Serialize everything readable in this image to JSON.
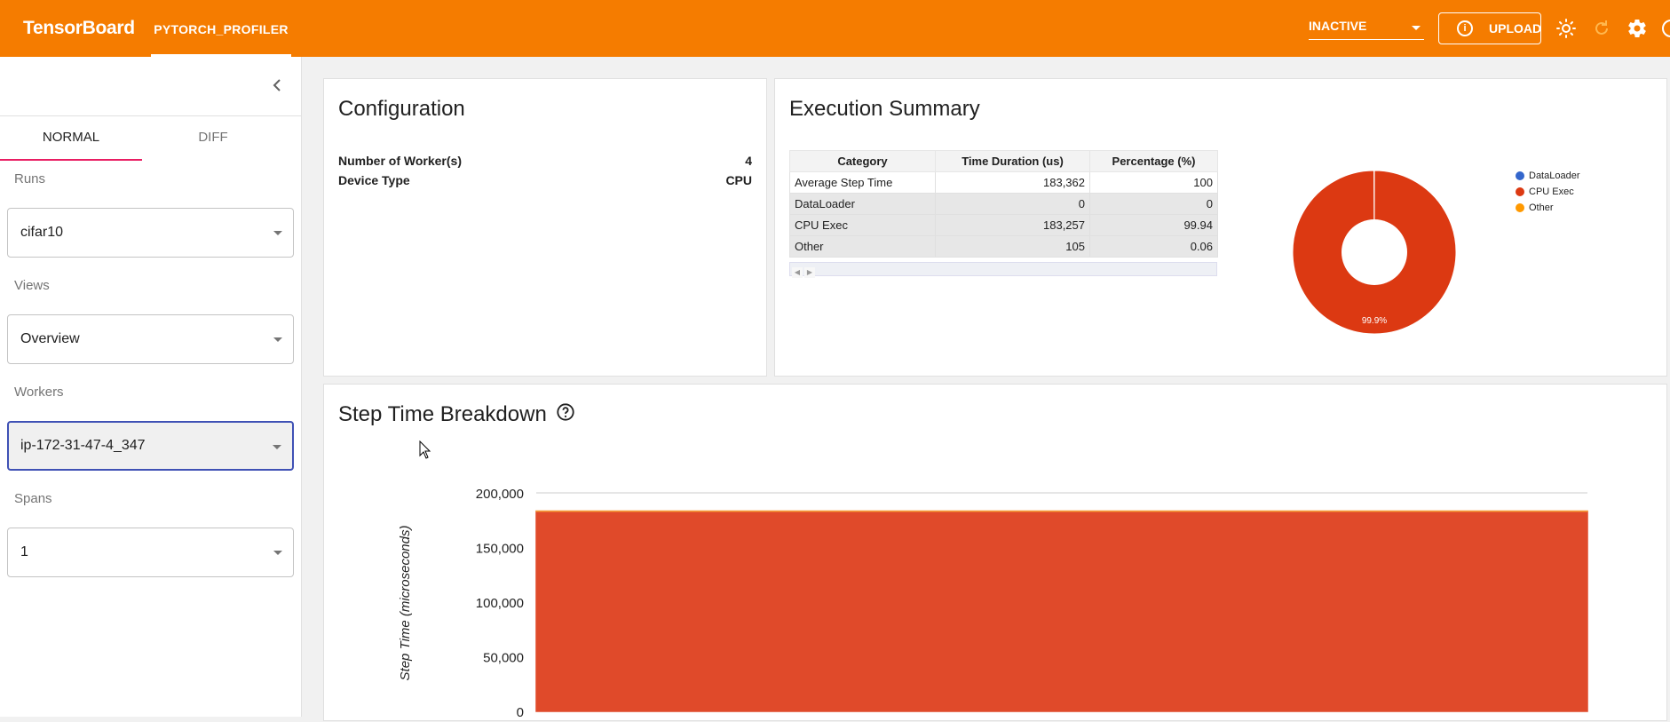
{
  "topbar": {
    "brand": "TensorBoard",
    "plugin_tab": "PYTORCH_PROFILER",
    "inactive_select": "INACTIVE",
    "upload_label": "UPLOAD",
    "icons": [
      "info-icon",
      "brightness-icon",
      "refresh-icon",
      "settings-icon",
      "help-icon"
    ]
  },
  "sidebar": {
    "tabs": [
      "NORMAL",
      "DIFF"
    ],
    "active_tab": "NORMAL",
    "fields": [
      {
        "label": "Runs",
        "value": "cifar10"
      },
      {
        "label": "Views",
        "value": "Overview"
      },
      {
        "label": "Workers",
        "value": "ip-172-31-47-4_347"
      },
      {
        "label": "Spans",
        "value": "1"
      }
    ]
  },
  "configuration": {
    "title": "Configuration",
    "rows": [
      {
        "key": "Number of Worker(s)",
        "value": "4"
      },
      {
        "key": "Device Type",
        "value": "CPU"
      }
    ]
  },
  "execution_summary": {
    "title": "Execution Summary",
    "table": {
      "headers": [
        "Category",
        "Time Duration (us)",
        "Percentage (%)"
      ],
      "rows": [
        [
          "Average Step Time",
          "183,362",
          "100"
        ],
        [
          "DataLoader",
          "0",
          "0"
        ],
        [
          "CPU Exec",
          "183,257",
          "99.94"
        ],
        [
          "Other",
          "105",
          "0.06"
        ]
      ]
    },
    "donut_label": "99.9%",
    "legend": [
      {
        "name": "DataLoader",
        "color": "#3366cc"
      },
      {
        "name": "CPU Exec",
        "color": "#dc3912"
      },
      {
        "name": "Other",
        "color": "#ff9900"
      }
    ],
    "donut_values": [
      0,
      183257,
      105
    ]
  },
  "step_time": {
    "title": "Step Time Breakdown"
  },
  "chart_data": {
    "type": "area",
    "ylabel": "Step Time (microseconds)",
    "ylim": [
      0,
      200000
    ],
    "yticks": [
      "200,000",
      "150,000",
      "100,000",
      "50,000",
      "0"
    ],
    "ytick_values": [
      200000,
      150000,
      100000,
      50000,
      0
    ],
    "series": [
      {
        "name": "CPU Exec",
        "color": "#e04a2a",
        "values": [
          183257,
          183257
        ]
      },
      {
        "name": "Other",
        "color": "#f7a23b",
        "values": [
          105,
          105
        ]
      }
    ],
    "grid": true
  }
}
